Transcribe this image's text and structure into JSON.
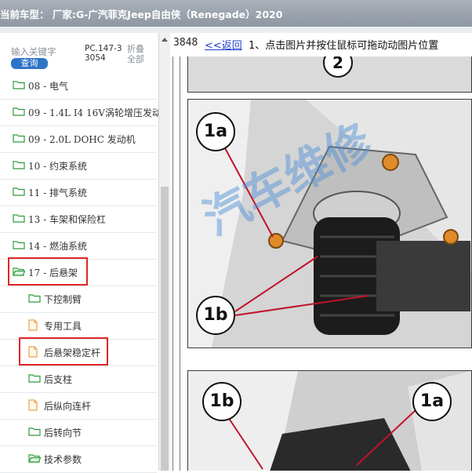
{
  "titlebar": {
    "title": "当前车型：  厂家:G-广汽菲克Jeep自由侠（Renegade）2020"
  },
  "sidebar": {
    "search_placeholder": "输入关键字",
    "query_label": "查询",
    "pc_code": "PC.147-33054",
    "fold_all": "折叠全部",
    "items": [
      {
        "label": "08 - 电气",
        "type": "folder"
      },
      {
        "label": "09 - 1.4L I4 16V涡轮增压发动",
        "type": "folder"
      },
      {
        "label": "09 - 2.0L DOHC 发动机",
        "type": "folder"
      },
      {
        "label": "10 - 约束系统",
        "type": "folder"
      },
      {
        "label": "11 - 排气系统",
        "type": "folder"
      },
      {
        "label": "13 - 车架和保险杠",
        "type": "folder"
      },
      {
        "label": "14 - 燃油系统",
        "type": "folder"
      },
      {
        "label": "17 - 后悬架",
        "type": "folder-open",
        "highlighted": true
      },
      {
        "label": "下控制臂",
        "type": "folder"
      },
      {
        "label": "专用工具",
        "type": "doc"
      },
      {
        "label": "后悬架稳定杆",
        "type": "doc",
        "highlighted": true
      },
      {
        "label": "后支柱",
        "type": "folder"
      },
      {
        "label": "后纵向连杆",
        "type": "doc"
      },
      {
        "label": "后转向节",
        "type": "folder"
      },
      {
        "label": "技术参数",
        "type": "folder-open"
      }
    ]
  },
  "content": {
    "id": "3848",
    "back_link": "<<返回",
    "instruction": "1、点击图片并按住鼠标可拖动动图片位置",
    "watermark": "汽车维修",
    "callouts": {
      "c2": "2",
      "c1a": "1a",
      "c1b": "1b"
    }
  },
  "colors": {
    "highlight": "#e02626",
    "folder": "#2f9b3c",
    "doc": "#e7a34a",
    "link": "#1a3fd0"
  }
}
